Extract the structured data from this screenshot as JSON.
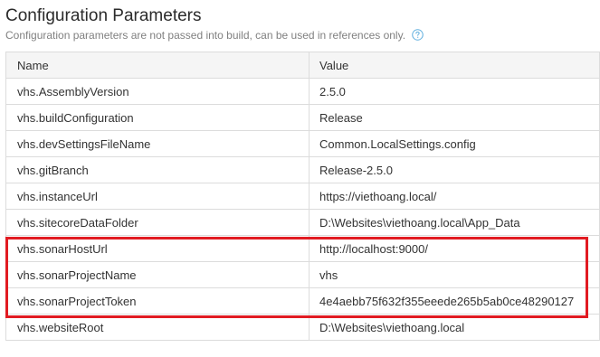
{
  "header": {
    "title": "Configuration Parameters",
    "subtitle": "Configuration parameters are not passed into build, can be used in references only.",
    "help_icon": "question-circle-icon",
    "accent_color": "#66b2e0"
  },
  "table": {
    "columns": [
      "Name",
      "Value"
    ],
    "rows": [
      {
        "name": "vhs.AssemblyVersion",
        "value": "2.5.0"
      },
      {
        "name": "vhs.buildConfiguration",
        "value": "Release"
      },
      {
        "name": "vhs.devSettingsFileName",
        "value": "Common.LocalSettings.config"
      },
      {
        "name": "vhs.gitBranch",
        "value": "Release-2.5.0"
      },
      {
        "name": "vhs.instanceUrl",
        "value": "https://viethoang.local/"
      },
      {
        "name": "vhs.sitecoreDataFolder",
        "value": "D:\\Websites\\viethoang.local\\App_Data"
      },
      {
        "name": "vhs.sonarHostUrl",
        "value": "http://localhost:9000/"
      },
      {
        "name": "vhs.sonarProjectName",
        "value": "vhs"
      },
      {
        "name": "vhs.sonarProjectToken",
        "value": "4e4aebb75f632f355eeede265b5ab0ce48290127"
      },
      {
        "name": "vhs.websiteRoot",
        "value": "D:\\Websites\\viethoang.local"
      }
    ]
  },
  "highlight_color": "#e11b22"
}
